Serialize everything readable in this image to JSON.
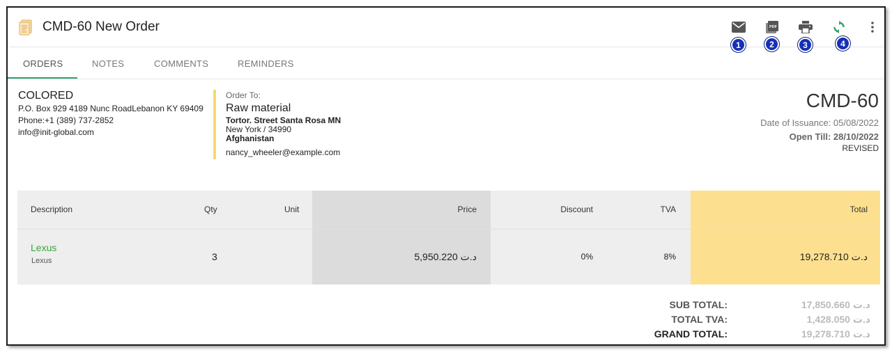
{
  "header": {
    "title": "CMD-60 New Order",
    "doc_icon": "document-icon",
    "actions": [
      {
        "name": "email-icon",
        "badge": "1"
      },
      {
        "name": "pdf-icon",
        "badge": "2",
        "label": "PDF"
      },
      {
        "name": "print-icon",
        "badge": "3"
      },
      {
        "name": "refresh-icon",
        "badge": "4"
      },
      {
        "name": "more-vert-icon"
      }
    ]
  },
  "tabs": [
    {
      "label": "ORDERS",
      "active": true
    },
    {
      "label": "NOTES"
    },
    {
      "label": "COMMENTS"
    },
    {
      "label": "REMINDERS"
    }
  ],
  "from": {
    "name": "COLORED",
    "address": "P.O. Box 929 4189 Nunc RoadLebanon KY 69409",
    "phone": "Phone:+1 (389) 737-2852",
    "email": "info@init-global.com"
  },
  "order_to": {
    "label": "Order To:",
    "name": "Raw material",
    "street": "Tortor. Street Santa Rosa MN",
    "city": "New York / 34990",
    "country": "Afghanistan",
    "email": "nancy_wheeler@example.com"
  },
  "order": {
    "number": "CMD-60",
    "issuance": "Date of Issuance: 05/08/2022",
    "open_till": "Open Till: 28/10/2022",
    "status": "REVISED"
  },
  "table": {
    "headers": {
      "description": "Description",
      "qty": "Qty",
      "unit": "Unit",
      "price": "Price",
      "discount": "Discount",
      "tva": "TVA",
      "total": "Total"
    },
    "rows": [
      {
        "name": "Lexus",
        "sub": "Lexus",
        "qty": "3",
        "unit": "",
        "price": "د.ت 5,950.220",
        "discount": "0%",
        "tva": "8%",
        "total": "د.ت 19,278.710"
      }
    ]
  },
  "totals": {
    "sub_total_label": "SUB TOTAL:",
    "sub_total": "د.ت 17,850.660",
    "total_tva_label": "TOTAL TVA:",
    "total_tva": "د.ت 1,428.050",
    "grand_total_label": "GRAND TOTAL:",
    "grand_total": "د.ت 19,278.710"
  },
  "colors": {
    "accent_green": "#2ea36b",
    "badge_blue": "#1530b8",
    "order_bar": "#f7d774",
    "total_col": "#fde08f"
  }
}
